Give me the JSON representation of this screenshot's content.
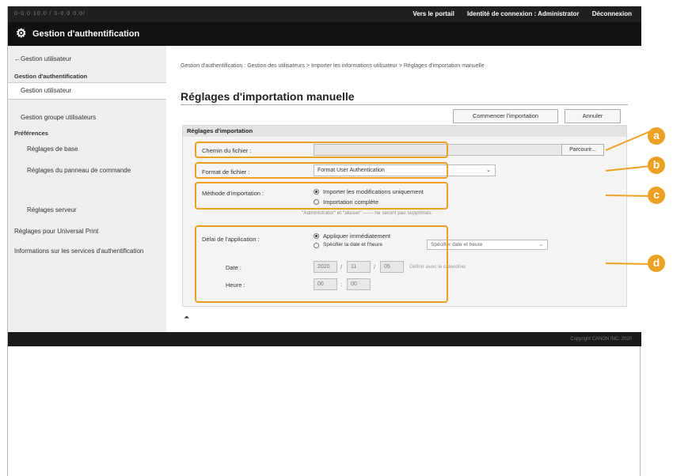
{
  "topbar": {
    "url": "0-0.0 10.0 / 0-0.0 0.0/",
    "portal": "Vers le portail",
    "identity": "Identité de connexion : Administrator",
    "logout": "Déconnexion"
  },
  "app": {
    "title": "Gestion d'authentification",
    "icon": "gear-icon"
  },
  "sidebar": {
    "back": "Gestion utilisateur",
    "section1": "Gestion d'authentification",
    "item_users": "Gestion utilisateur",
    "item_groups": "Gestion groupe utilisateurs",
    "section2": "Préférences",
    "item_basic": "Réglages de base",
    "item_panel": "Réglages du panneau de commande",
    "item_server": "Réglages serveur",
    "item_universal": "Réglages pour Universal Print",
    "item_info": "Informations sur les services d'authentification"
  },
  "main": {
    "breadcrumb": "Gestion d'authentification : Gestion des utilisateurs > Importer les informations utilisateur > Réglages d'importation manuelle",
    "title": "Réglages d'importation manuelle",
    "start_button": "Commencer l'importation",
    "cancel_button": "Annuler",
    "section_title": "Réglages d'importation",
    "file_path_label": "Chemin du fichier :",
    "browse_button": "Parcourir...",
    "file_format_label": "Format de fichier :",
    "file_format_value": "Format User Authentication",
    "method_label": "Méthode d'importation :",
    "method_opt1": "Importer les modifications uniquement",
    "method_opt2": "Importation complète",
    "method_note": "\"Administrator\" et \"aliuser\" ------ ne seront pas supprimés.",
    "apply_label": "Délai de l'application :",
    "apply_opt1": "Appliquer immédiatement",
    "apply_opt2": "Spécifier la date et l'heure",
    "apply_select": "Spécifier date et heure",
    "date_label": "Date :",
    "date_year": "2020",
    "date_month": "11",
    "date_day": "05",
    "calendar_link": "Définir avec le calendrier",
    "time_label": "Heure :",
    "time_hour": "00",
    "time_min": "00"
  },
  "callouts": {
    "a": "a",
    "b": "b",
    "c": "c",
    "d": "d"
  },
  "footer": {
    "copyright": "Copyright CANON INC. 2020"
  },
  "colors": {
    "accent": "#f0a020",
    "topbar": "#1f1f1f",
    "sidebar": "#eeeeee"
  }
}
